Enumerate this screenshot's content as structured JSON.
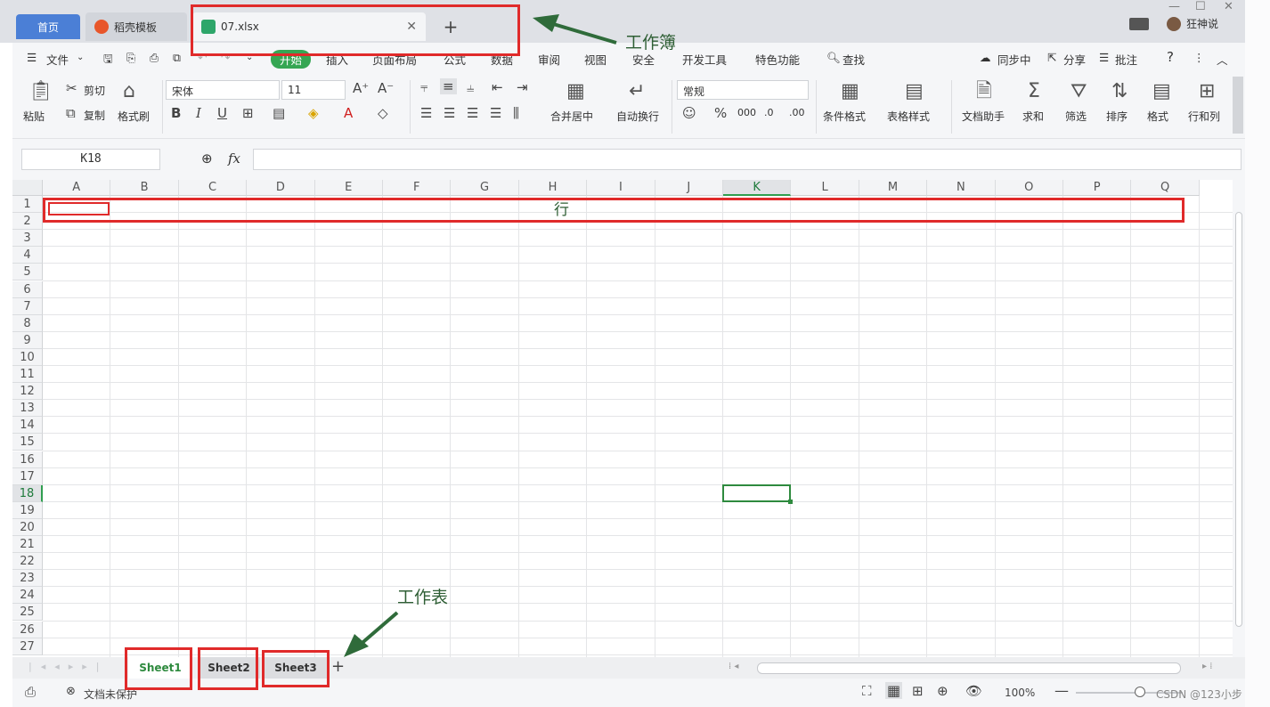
{
  "tabs": {
    "home": "首页",
    "template": "稻壳模板",
    "file": "07.xlsx",
    "add": "+"
  },
  "titlebar": {
    "user": "狂神说",
    "minimize": "—",
    "maximize": "☐",
    "close": "✕"
  },
  "menu": {
    "file": "文件",
    "items": [
      "开始",
      "插入",
      "页面布局",
      "公式",
      "数据",
      "审阅",
      "视图",
      "安全",
      "开发工具",
      "特色功能"
    ],
    "search": "查找",
    "sync": "同步中",
    "share": "分享",
    "comment": "批注",
    "help": "?"
  },
  "ribbon": {
    "paste": "粘贴",
    "cut": "剪切",
    "copy": "复制",
    "format_painter": "格式刷",
    "font_name": "宋体",
    "font_size": "11",
    "bold": "B",
    "italic": "I",
    "underline": "U",
    "merge": "合并居中",
    "wrap": "自动换行",
    "number_format": "常规",
    "percent": "%",
    "cond_format": "条件格式",
    "table_style": "表格样式",
    "doc_helper": "文档助手",
    "sum": "求和",
    "filter": "筛选",
    "sort": "排序",
    "format": "格式",
    "row_col": "行和列"
  },
  "formula": {
    "name_box": "K18",
    "fx": "fx",
    "value": ""
  },
  "columns": [
    "A",
    "B",
    "C",
    "D",
    "E",
    "F",
    "G",
    "H",
    "I",
    "J",
    "K",
    "L",
    "M",
    "N",
    "O",
    "P",
    "Q"
  ],
  "rows": [
    "1",
    "2",
    "3",
    "4",
    "5",
    "6",
    "7",
    "8",
    "9",
    "10",
    "11",
    "12",
    "13",
    "14",
    "15",
    "16",
    "17",
    "18",
    "19",
    "20",
    "21",
    "22",
    "23",
    "24",
    "25",
    "26",
    "27"
  ],
  "selected": {
    "column": "K",
    "row": "18"
  },
  "sheets": [
    "Sheet1",
    "Sheet2",
    "Sheet3"
  ],
  "status": {
    "protect": "文档未保护",
    "zoom": "100%",
    "watermark": "CSDN @123小步"
  },
  "annotations": {
    "workbook": "工作簿",
    "row": "行",
    "worksheet": "工作表"
  },
  "colors": {
    "accent": "#36a653",
    "annotation_box": "#e02a2a",
    "arrow": "#2f6b3a"
  }
}
